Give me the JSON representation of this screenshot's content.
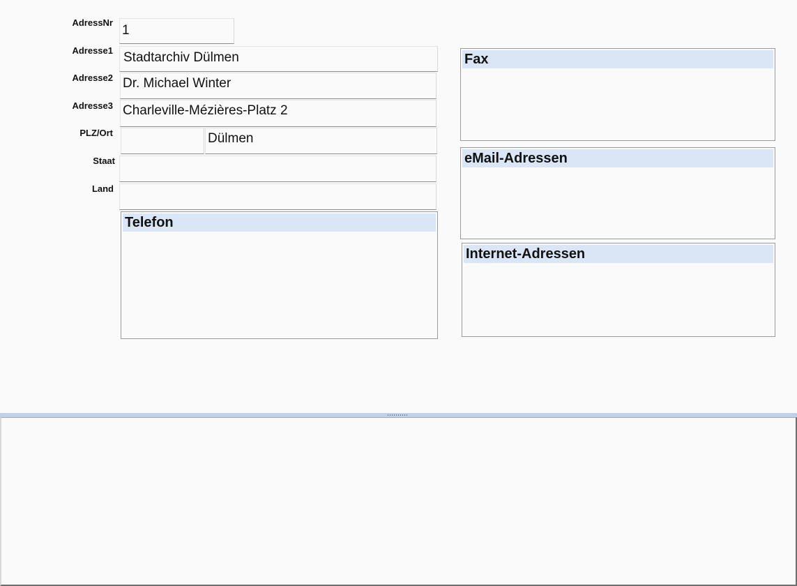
{
  "form": {
    "labels": {
      "adressnr": "AdressNr",
      "adresse1": "Adresse1",
      "adresse2": "Adresse2",
      "adresse3": "Adresse3",
      "plz_ort": "PLZ/Ort",
      "staat": "Staat",
      "land": "Land"
    },
    "values": {
      "adressnr": "1",
      "adresse1": "Stadtarchiv Dülmen",
      "adresse2": "Dr. Michael Winter",
      "adresse3": "Charleville-Mézières-Platz 2",
      "plz": "",
      "ort": "Dülmen",
      "staat": "",
      "land": ""
    }
  },
  "panels": {
    "telefon": "Telefon",
    "fax": "Fax",
    "email": "eMail-Adressen",
    "internet": "Internet-Adressen"
  },
  "colors": {
    "background": "#fafafa",
    "panel_header": "#dae6f6",
    "splitter": "#c0d3e6"
  }
}
